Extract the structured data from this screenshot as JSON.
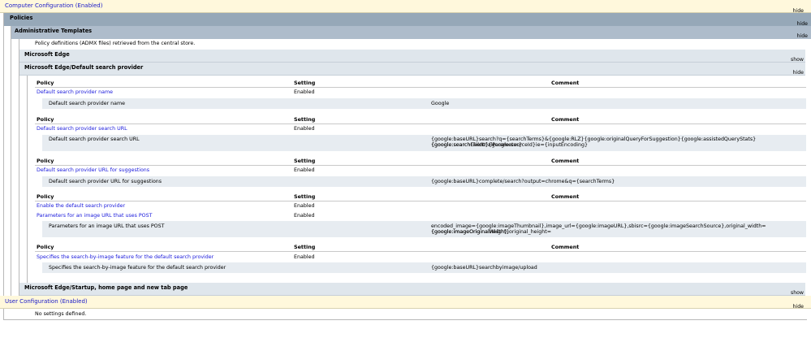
{
  "computer_config": {
    "title": "Computer Configuration (Enabled)",
    "toggle": "hide"
  },
  "policies": {
    "title": "Policies",
    "toggle": "hide"
  },
  "admin_templates": {
    "title": "Administrative Templates",
    "toggle": "hide",
    "note": "Policy definitions (ADMX files) retrieved from the central store."
  },
  "edge": {
    "title": "Microsoft Edge",
    "toggle": "show"
  },
  "edge_search": {
    "title": "Microsoft Edge/Default search provider",
    "toggle": "hide"
  },
  "columns": {
    "policy": "Policy",
    "setting": "Setting",
    "comment": "Comment"
  },
  "groups": [
    {
      "policies": [
        {
          "name": "Default search provider name",
          "setting": "Enabled"
        }
      ],
      "detail": {
        "label": "Default search provider name",
        "value": "Google"
      }
    },
    {
      "policies": [
        {
          "name": "Default search provider search URL",
          "setting": "Enabled"
        }
      ],
      "detail": {
        "label": "Default search provider search URL",
        "value_line1": "{google:baseURL}search?q={searchTerms}&{google:RLZ}{google:originalQueryForSuggestion}{google:assistedQueryStats}{google:searchFieldtrialParameter}",
        "value_line2": "{google:searchClient}{google:sourceId}ie={inputEncoding}"
      }
    },
    {
      "policies": [
        {
          "name": "Default search provider URL for suggestions",
          "setting": "Enabled"
        }
      ],
      "detail": {
        "label": "Default search provider URL for suggestions",
        "value": "{google:baseURL}complete/search?output=chrome&q={searchTerms}"
      }
    },
    {
      "policies": [
        {
          "name": "Enable the default search provider",
          "setting": "Enabled"
        },
        {
          "name": "Parameters for an image URL that uses POST",
          "setting": "Enabled"
        }
      ],
      "detail": {
        "label": "Parameters for an image URL that uses POST",
        "value_line1": "encoded_image={google:imageThumbnail},image_url={google:imageURL},sbisrc={google:imageSearchSource},original_width={google:imageOriginalWidth},original_height=",
        "value_line2": "{google:imageOriginalHeight}"
      }
    },
    {
      "policies": [
        {
          "name": "Specifies the search-by-image feature for the default search provider",
          "setting": "Enabled"
        }
      ],
      "detail": {
        "label": "Specifies the search-by-image feature for the default search provider",
        "value": "{google:baseURL}searchbyimage/upload"
      }
    }
  ],
  "edge_startup": {
    "title": "Microsoft Edge/Startup, home page and new tab page",
    "toggle": "show"
  },
  "user_config": {
    "title": "User Configuration (Enabled)",
    "toggle": "hide",
    "note": "No settings defined."
  }
}
